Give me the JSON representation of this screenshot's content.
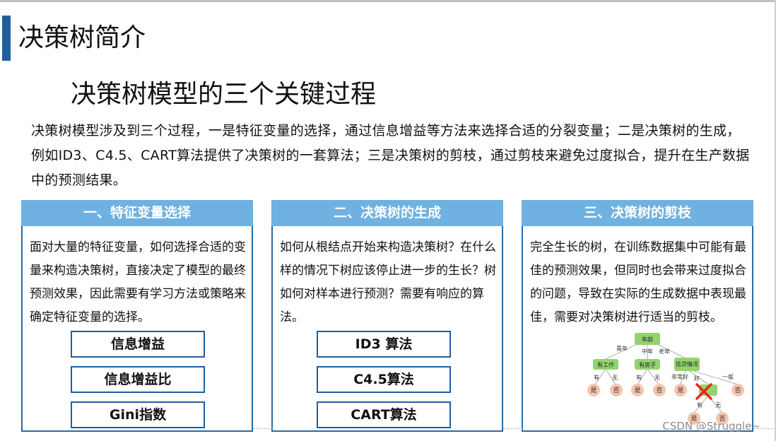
{
  "slide": {
    "title": "决策树简介",
    "subtitle": "决策树模型的三个关键过程",
    "intro": "决策树模型涉及到三个过程，一是特征变量的选择，通过信息增益等方法来选择合适的分裂变量；二是决策树的生成，例如ID3、C4.5、CART算法提供了决策树的一套算法；三是决策树的剪枝，通过剪枝来避免过度拟合，提升在生产数据中的预测结果。"
  },
  "panels": [
    {
      "header": "一、特征变量选择",
      "body": "面对大量的特征变量，如何选择合适的变量来构造决策树，直接决定了模型的最终预测效果，因此需要有学习方法或策略来确定特征变量的选择。",
      "buttons": [
        "信息增益",
        "信息增益比",
        "Gini指数"
      ]
    },
    {
      "header": "二、决策树的生成",
      "body": "如何从根结点开始来构造决策树？在什么样的情况下树应该停止进一步的生长？树如何对样本进行预测？需要有响应的算法。",
      "buttons": [
        "ID3 算法",
        "C4.5算法",
        "CART算法"
      ]
    },
    {
      "header": "三、决策树的剪枝",
      "body": "完全生长的树，在训练数据集中可能有最佳的预测效果，但同时也会带来过度拟合的问题，导致在实际的生成数据中表现最佳，需要对决策树进行适当的剪枝。"
    }
  ],
  "tree": {
    "root": "年龄",
    "edges": [
      "青年",
      "中年",
      "老年",
      "有",
      "无",
      "有",
      "无",
      "非常好",
      "好",
      "一般",
      "有",
      "无"
    ],
    "nodes": [
      "有工作",
      "有房子",
      "信贷情况"
    ],
    "leaves": [
      "是",
      "否",
      "是",
      "否",
      "是",
      "否",
      "是",
      "否"
    ],
    "colors": {
      "node": "#92d36e",
      "leaf": "#f6c4ad",
      "cross": "#e8261c"
    }
  },
  "watermark": "CSDN @Struggle~",
  "colors": {
    "accent": "#1f5fa0",
    "header": "#6fb1e0",
    "border": "#2b6ba3"
  }
}
